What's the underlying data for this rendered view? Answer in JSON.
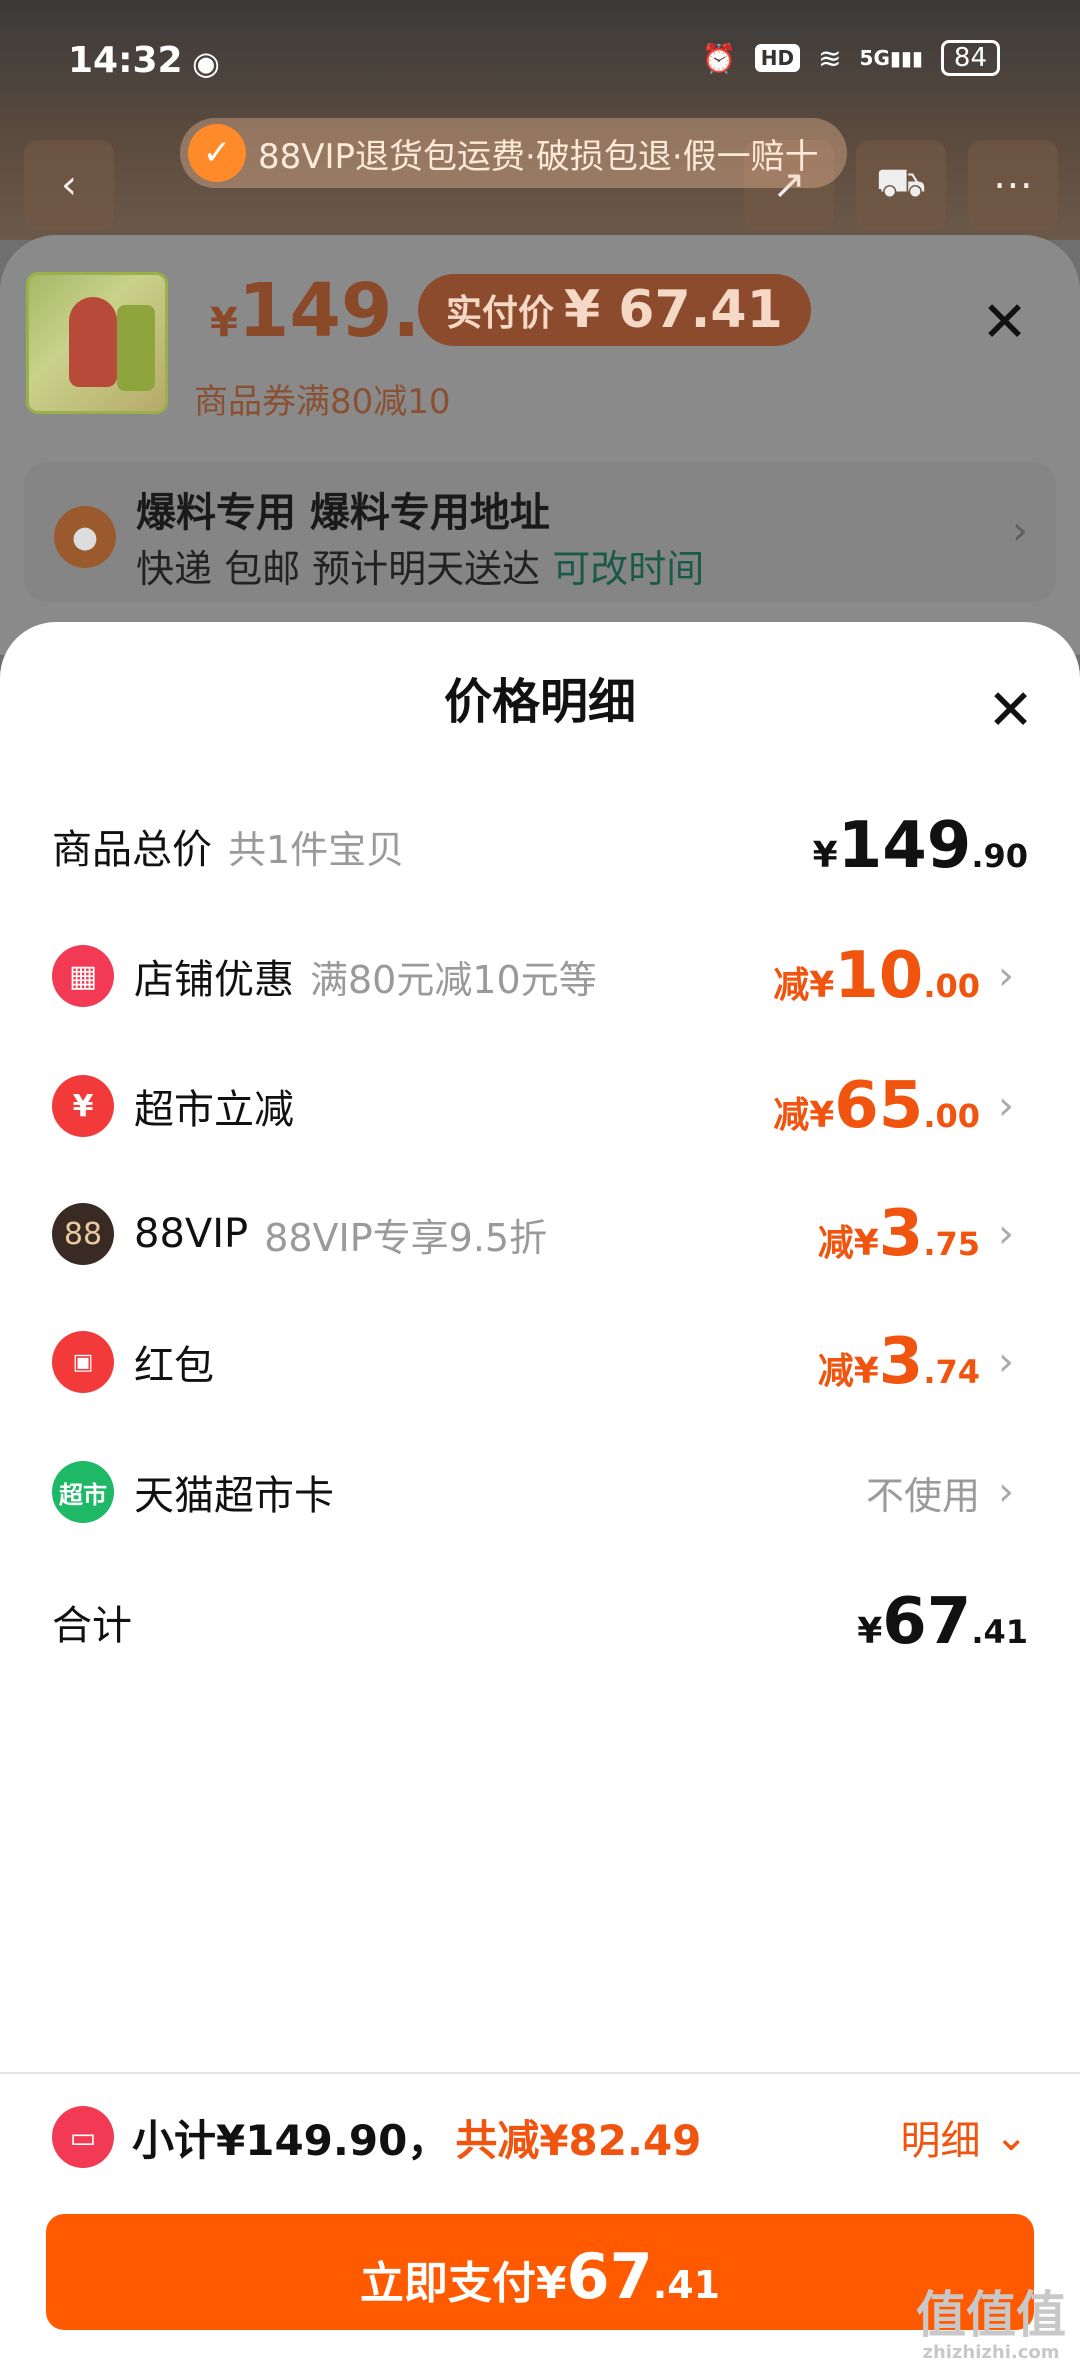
{
  "status_bar": {
    "time": "14:32",
    "hd": "HD",
    "signal": "5G",
    "battery": "84"
  },
  "banner": {
    "text": "88VIP退货包运费·破损包退·假一赔十"
  },
  "product": {
    "currency": "¥",
    "price": "149.9",
    "real_price_label": "实付价",
    "real_price": "¥ 67.41",
    "coupon": "商品券满80减10"
  },
  "address": {
    "title": "爆料专用 爆料专用地址",
    "delivery": "快递 包邮 预计明天送达",
    "change_time": "可改时间"
  },
  "price_detail": {
    "title": "价格明细",
    "rows": [
      {
        "label": "商品总价",
        "desc": "共1件宝贝",
        "prefix": "¥",
        "int": "149",
        "dec": ".90"
      },
      {
        "label": "店铺优惠",
        "desc": "满80元减10元等",
        "prefix": "减¥",
        "int": "10",
        "dec": ".00"
      },
      {
        "label": "超市立减",
        "desc": "",
        "prefix": "减¥",
        "int": "65",
        "dec": ".00"
      },
      {
        "label": "88VIP",
        "desc": "88VIP专享9.5折",
        "prefix": "减¥",
        "int": "3",
        "dec": ".75"
      },
      {
        "label": "红包",
        "desc": "",
        "prefix": "减¥",
        "int": "3",
        "dec": ".74"
      },
      {
        "label": "天猫超市卡",
        "desc": "",
        "value_text": "不使用"
      },
      {
        "label": "合计",
        "desc": "",
        "prefix": "¥",
        "int": "67",
        "dec": ".41"
      }
    ],
    "icon_text": {
      "vip": "88",
      "coupon": "¥",
      "card": "超市"
    }
  },
  "summary": {
    "subtotal": "小计¥149.90，",
    "saved": "共减¥82.49",
    "detail": "明细"
  },
  "pay_button": {
    "label": "立即支付¥",
    "int": "67",
    "dec": ".41"
  },
  "watermark": {
    "main": "值值值",
    "sub": "zhizhizhi.com"
  },
  "colors": {
    "accent": "#f0540e",
    "pay": "#ff5a00",
    "shop_icon": "#f23a55",
    "card_icon": "#1fb866"
  }
}
